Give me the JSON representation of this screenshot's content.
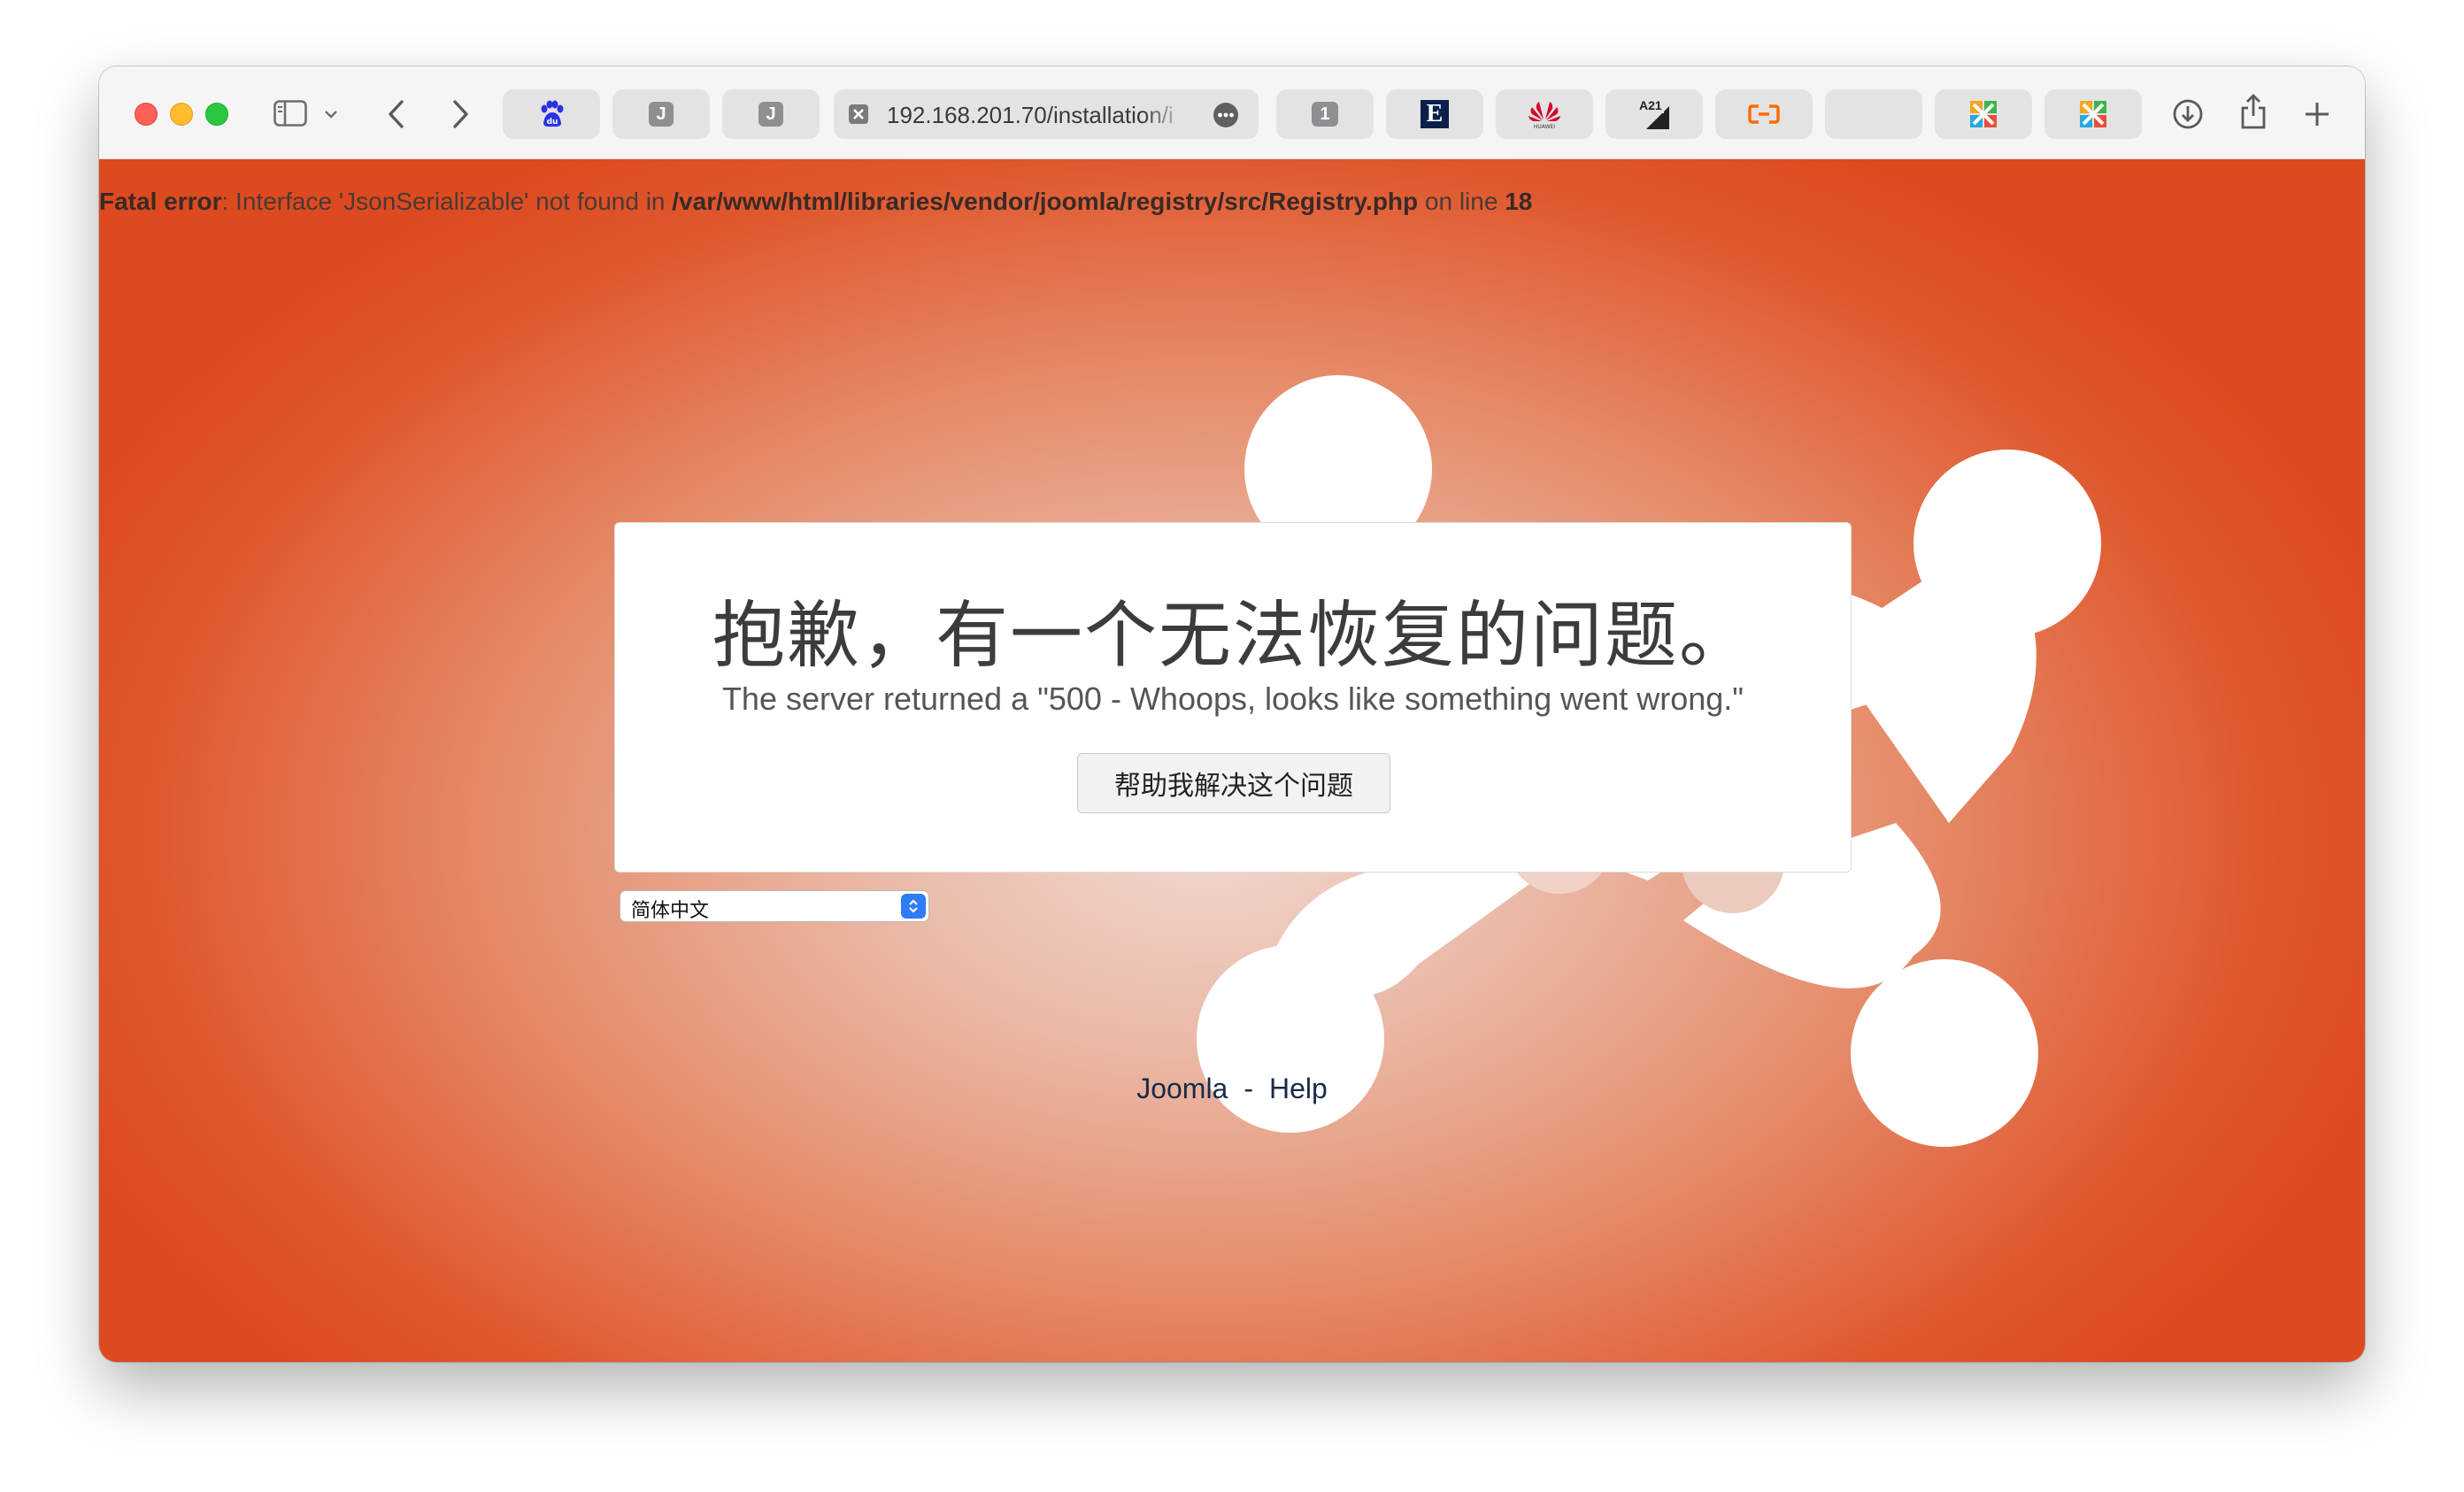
{
  "browser": {
    "url_display": "192.168.201.70/installation/i",
    "tabs": [
      {
        "name": "baidu",
        "icon": "baidu-paw-icon"
      },
      {
        "name": "joomla-1",
        "icon_letter": "J"
      },
      {
        "name": "joomla-2",
        "icon_letter": "J"
      },
      {
        "name": "tab-1",
        "icon_letter": "1"
      },
      {
        "name": "economist",
        "icon_letter": "E"
      },
      {
        "name": "huawei",
        "icon": "huawei-logo-icon",
        "icon_label": "HUAWEI"
      },
      {
        "name": "a21",
        "icon_letter": "A21"
      },
      {
        "name": "aliyun",
        "icon": "aliyun-logo-icon"
      },
      {
        "name": "blank",
        "icon": ""
      },
      {
        "name": "pinwheel-1",
        "icon": "pinwheel-icon"
      },
      {
        "name": "pinwheel-2",
        "icon": "pinwheel-icon"
      }
    ]
  },
  "page": {
    "fatal": {
      "label": "Fatal error",
      "message": ": Interface 'JsonSerializable' not found in ",
      "path": "/var/www/html/libraries/vendor/joomla/registry/src/Registry.php",
      "on_line": " on line ",
      "line": "18"
    },
    "card": {
      "title": "抱歉，有一个无法恢复的问题。",
      "subtitle": "The server returned a \"500 - Whoops, looks like something went wrong.\"",
      "help_button": "帮助我解决这个问题"
    },
    "language_select": {
      "selected": "简体中文"
    },
    "footer": {
      "joomla": "Joomla",
      "separator": "-",
      "help": "Help"
    }
  },
  "colors": {
    "accent_orange": "#dd4a1f",
    "select_blue": "#2f7cf6",
    "aliyun_orange": "#ff6a00",
    "huawei_red": "#cf0a2c"
  }
}
